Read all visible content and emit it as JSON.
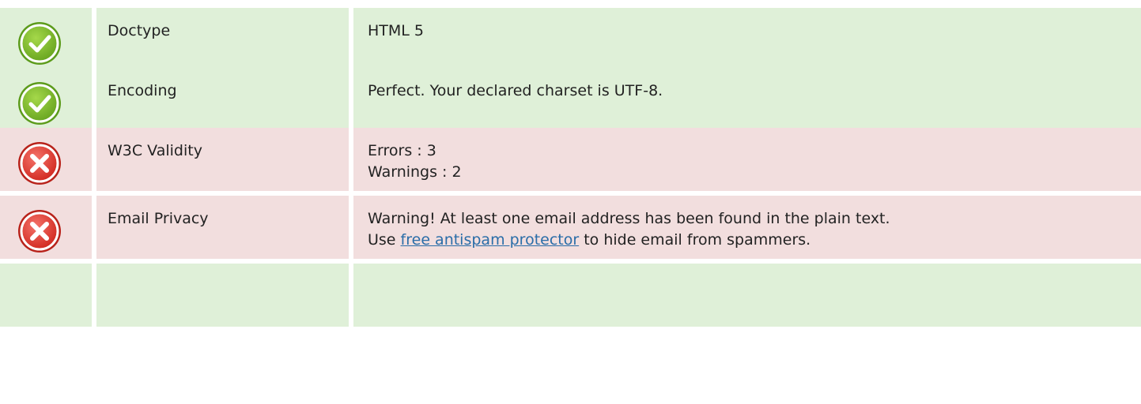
{
  "rows": [
    {
      "status": "pass",
      "icon": "check-circle-icon",
      "label": "Doctype",
      "value_lines": [
        "HTML 5"
      ]
    },
    {
      "status": "pass",
      "icon": "check-circle-icon",
      "label": "Encoding",
      "value_lines": [
        "Perfect. Your declared charset is UTF-8."
      ]
    },
    {
      "status": "fail",
      "icon": "cross-circle-icon",
      "label": "W3C Validity",
      "value_lines": [
        "Errors : 3",
        "Warnings : 2"
      ]
    },
    {
      "status": "fail",
      "icon": "cross-circle-icon",
      "label": "Email Privacy",
      "value_lines": [
        "Warning! At least one email address has been found in the plain text."
      ],
      "value_line2": {
        "prefix": "Use ",
        "link_text": "free antispam protector",
        "suffix": " to hide email from spammers."
      }
    }
  ],
  "colors": {
    "pass_background": "#dff0d8",
    "fail_background": "#f2dede",
    "check_icon_green": "#7ab82a",
    "cross_icon_red": "#e0352b",
    "link": "#2a6da8",
    "text": "#222222"
  }
}
